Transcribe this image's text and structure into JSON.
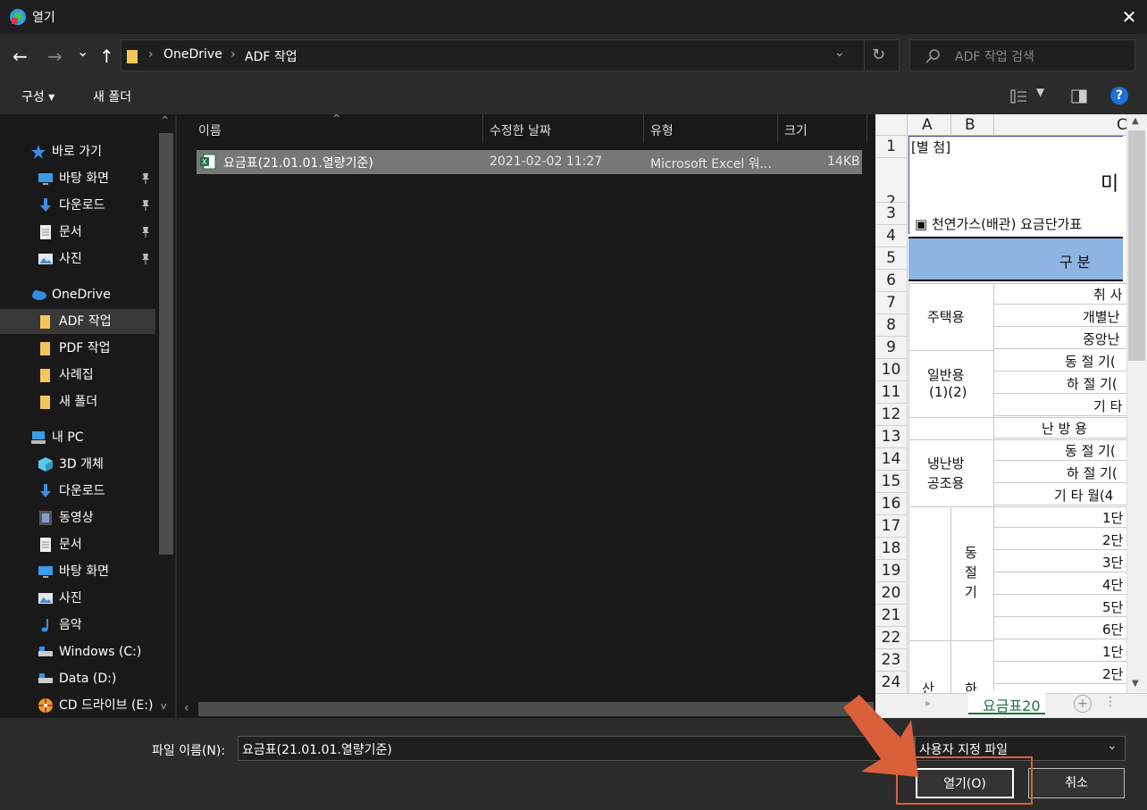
{
  "window": {
    "title": "열기",
    "close_glyph": "✕"
  },
  "nav": {
    "back": "←",
    "forward": "→",
    "recent": "⌄",
    "up": "↑",
    "breadcrumb": [
      "OneDrive",
      "ADF 작업"
    ],
    "refresh": "↻",
    "search_placeholder": "ADF 작업 검색"
  },
  "toolbar": {
    "organize": "구성 ▾",
    "new_folder": "새 폴더",
    "help": "?"
  },
  "sidebar": {
    "items": [
      {
        "label": "바로 가기",
        "icon": "star-icon",
        "indent": 0,
        "pinned": false
      },
      {
        "label": "바탕 화면",
        "icon": "desktop-icon",
        "indent": 1,
        "pinned": true
      },
      {
        "label": "다운로드",
        "icon": "download-icon",
        "indent": 1,
        "pinned": true
      },
      {
        "label": "문서",
        "icon": "document-icon",
        "indent": 1,
        "pinned": true
      },
      {
        "label": "사진",
        "icon": "pictures-icon",
        "indent": 1,
        "pinned": true
      },
      {
        "label": "OneDrive",
        "icon": "cloud-icon",
        "indent": 0,
        "pinned": false
      },
      {
        "label": "ADF 작업",
        "icon": "folder-icon",
        "indent": 1,
        "pinned": false,
        "selected": true
      },
      {
        "label": "PDF 작업",
        "icon": "folder-icon",
        "indent": 1,
        "pinned": false
      },
      {
        "label": "사례집",
        "icon": "folder-icon",
        "indent": 1,
        "pinned": false
      },
      {
        "label": "새 폴더",
        "icon": "folder-icon",
        "indent": 1,
        "pinned": false
      },
      {
        "label": "내 PC",
        "icon": "pc-icon",
        "indent": 0,
        "pinned": false
      },
      {
        "label": "3D 개체",
        "icon": "cube-icon",
        "indent": 1,
        "pinned": false
      },
      {
        "label": "다운로드",
        "icon": "download-icon",
        "indent": 1,
        "pinned": false
      },
      {
        "label": "동영상",
        "icon": "video-icon",
        "indent": 1,
        "pinned": false
      },
      {
        "label": "문서",
        "icon": "document-icon",
        "indent": 1,
        "pinned": false
      },
      {
        "label": "바탕 화면",
        "icon": "desktop-icon",
        "indent": 1,
        "pinned": false
      },
      {
        "label": "사진",
        "icon": "pictures-icon",
        "indent": 1,
        "pinned": false
      },
      {
        "label": "음악",
        "icon": "music-icon",
        "indent": 1,
        "pinned": false
      },
      {
        "label": "Windows (C:)",
        "icon": "drive-icon",
        "indent": 1,
        "pinned": false
      },
      {
        "label": "Data (D:)",
        "icon": "drive-icon",
        "indent": 1,
        "pinned": false
      },
      {
        "label": "CD 드라이브 (E:)",
        "icon": "cd-drive-icon",
        "indent": 1,
        "pinned": false
      }
    ]
  },
  "files": {
    "columns": {
      "name": "이름",
      "date": "수정한 날짜",
      "type": "유형",
      "size": "크기"
    },
    "rows": [
      {
        "name": "요금표(21.01.01.열량기준)",
        "date": "2021-02-02 11:27",
        "type": "Microsoft Excel 워...",
        "size": "14KB"
      }
    ]
  },
  "preview": {
    "col_headers": [
      "A",
      "B",
      "C"
    ],
    "row_numbers": [
      "1",
      "2",
      "3",
      "4",
      "5",
      "6",
      "7",
      "8",
      "9",
      "10",
      "11",
      "12",
      "13",
      "14",
      "15",
      "16",
      "17",
      "18",
      "19",
      "20",
      "21",
      "22",
      "23",
      "24"
    ],
    "cells": {
      "r1": "[별  첨]",
      "r2": "미",
      "r3": "▣ 천연가스(배관) 요금단가표",
      "header": "구 분",
      "residential": "주택용",
      "r6": "취 사",
      "r7": "개별난",
      "r8": "중앙난",
      "general": "일반용",
      "general_sub": "(1)(2)",
      "r9": "동 절 기(",
      "r10": "하 절 기(",
      "r11": "기  타",
      "r12": "난  방  용",
      "cooling1": "냉난방",
      "cooling2": "공조용",
      "r13": "동 절 기(",
      "r14": "하 절 기(",
      "r15": "기 타 월(4",
      "winter": [
        "동",
        "절",
        "기"
      ],
      "steps": [
        "1단",
        "2단",
        "3단",
        "4단",
        "5단",
        "6단",
        "1단",
        "2단"
      ],
      "bottom_a": "산",
      "bottom_b": "하"
    },
    "sheet_tab": "요금표20"
  },
  "bottom": {
    "filename_label": "파일 이름(N):",
    "filename_value": "요금표(21.01.01.열량기준)",
    "filter": "사용자 지정 파일",
    "open": "열기(O)",
    "cancel": "취소"
  },
  "colors": {
    "accent": "#1e90ff",
    "arrow": "#d9603b",
    "selection": "#777777",
    "header_fill": "#8db4e2"
  }
}
